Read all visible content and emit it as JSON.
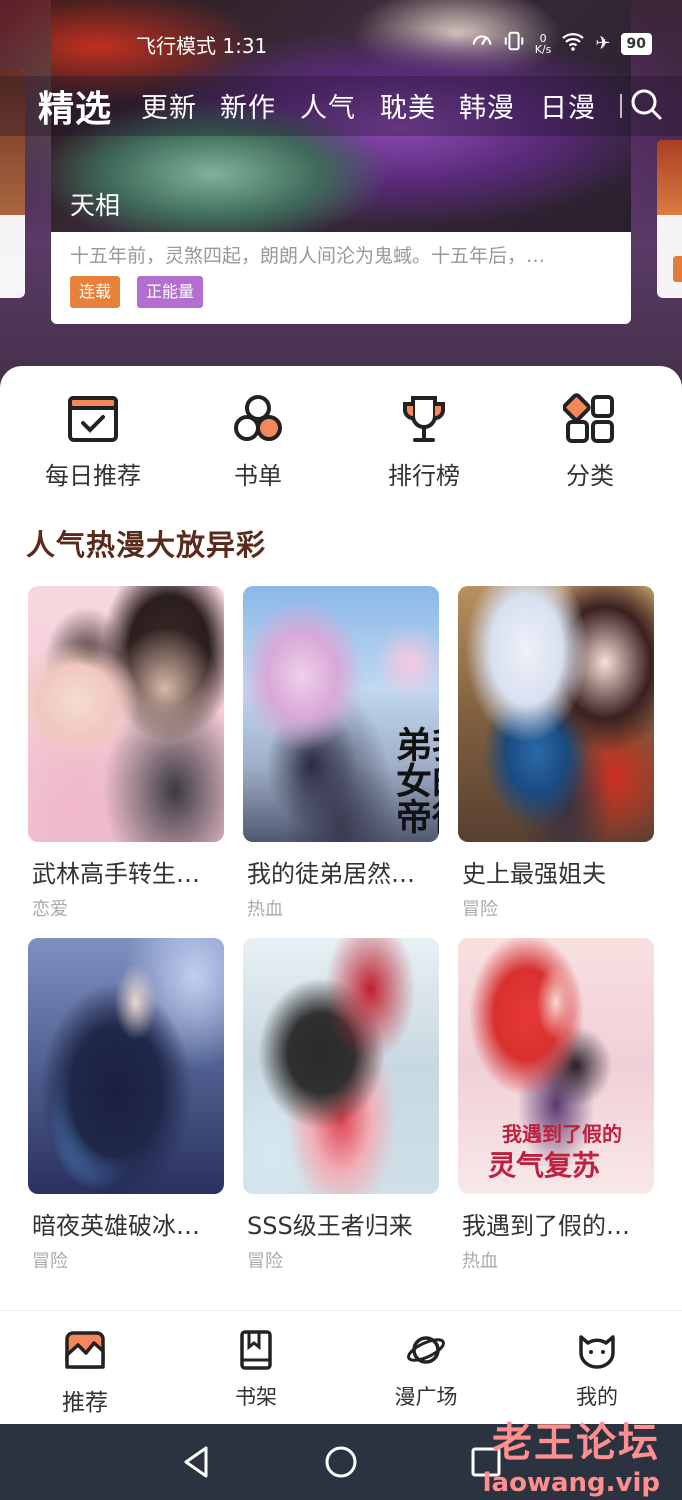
{
  "status_bar": {
    "time": "飞行模式 1:31",
    "net_speed_value": "0",
    "net_speed_unit": "K/s",
    "battery": "90"
  },
  "top_nav": {
    "tabs": [
      {
        "label": "精选",
        "active": true
      },
      {
        "label": "更新"
      },
      {
        "label": "新作"
      },
      {
        "label": "人气"
      },
      {
        "label": "耽美"
      },
      {
        "label": "韩漫"
      },
      {
        "label": "日漫"
      }
    ]
  },
  "hero": {
    "title": "天相",
    "description": "十五年前，灵煞四起，朗朗人间沦为鬼蜮。十五年后，…",
    "tags": [
      "连载",
      "正能量"
    ],
    "tag_colors": [
      "#e8813a",
      "#b36fcf"
    ]
  },
  "quick_links": [
    {
      "label": "每日推荐",
      "icon": "calendar-check-icon"
    },
    {
      "label": "书单",
      "icon": "circles-icon"
    },
    {
      "label": "排行榜",
      "icon": "trophy-icon"
    },
    {
      "label": "分类",
      "icon": "category-grid-icon"
    }
  ],
  "section": {
    "title": "人气热漫大放异彩"
  },
  "books": [
    {
      "title": "武林高手转生…",
      "genre": "恋爱"
    },
    {
      "title": "我的徒弟居然…",
      "genre": "热血",
      "cover_text": "我的徒弟女帝"
    },
    {
      "title": "史上最强姐夫",
      "genre": "冒险"
    },
    {
      "title": "暗夜英雄破冰…",
      "genre": "冒险"
    },
    {
      "title": "SSS级王者归来",
      "genre": "冒险"
    },
    {
      "title": "我遇到了假的…",
      "genre": "热血",
      "cover_text_1": "我遇到了假的",
      "cover_text_2": "灵气复苏"
    }
  ],
  "bottom_nav": [
    {
      "label": "推荐",
      "icon": "recommend-icon",
      "active": true
    },
    {
      "label": "书架",
      "icon": "bookshelf-icon"
    },
    {
      "label": "漫广场",
      "icon": "planet-icon"
    },
    {
      "label": "我的",
      "icon": "cat-face-icon"
    }
  ],
  "watermark": {
    "cn": "老王论坛",
    "en": "laowang.vip"
  },
  "colors": {
    "accent_orange": "#e8813a",
    "section_title": "#5a2a1a",
    "system_bar": "#2c3340"
  }
}
